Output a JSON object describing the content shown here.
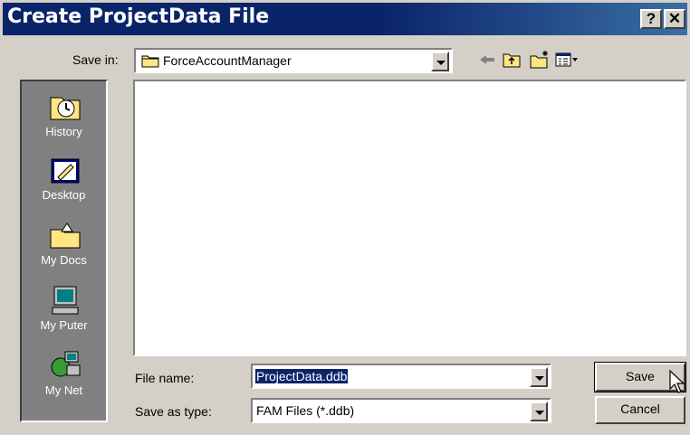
{
  "window": {
    "title": "Create ProjectData File",
    "help_btn": "?",
    "close_btn": "✕"
  },
  "savein": {
    "label": "Save in:",
    "value": "ForceAccountManager"
  },
  "places": [
    {
      "label": "History",
      "icon": "history-icon"
    },
    {
      "label": "Desktop",
      "icon": "desktop-icon"
    },
    {
      "label": "My Docs",
      "icon": "my-docs-icon"
    },
    {
      "label": "My Puter",
      "icon": "my-computer-icon"
    },
    {
      "label": "My Net",
      "icon": "my-network-icon"
    }
  ],
  "filename": {
    "label": "File name:",
    "value": "ProjectData.ddb"
  },
  "savetype": {
    "label": "Save as type:",
    "value": "FAM Files (*.ddb)"
  },
  "buttons": {
    "save": "Save",
    "cancel": "Cancel"
  },
  "toolbar": [
    "back-icon",
    "up-folder-icon",
    "new-folder-icon",
    "view-menu-icon"
  ]
}
